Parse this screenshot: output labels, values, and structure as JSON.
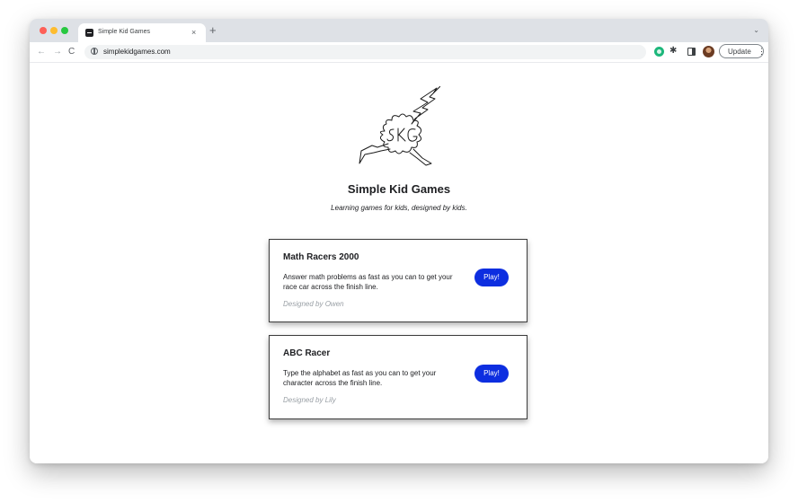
{
  "browser": {
    "tab_title": "Simple Kid Games",
    "tab_close": "×",
    "new_tab": "+",
    "tabs_dropdown": "⌄",
    "url": "simplekidgames.com",
    "nav_back": "←",
    "nav_forward": "→",
    "nav_reload": "C",
    "extension_puzzle": "✱",
    "update_label": "Update",
    "update_menu": "⋮"
  },
  "page": {
    "logo_text": "SKG",
    "title": "Simple Kid Games",
    "tagline": "Learning games for kids, designed by kids."
  },
  "games": [
    {
      "title": "Math Racers 2000",
      "description": "Answer math problems as fast as you can to get your race car across the finish line.",
      "credit": "Designed by Owen",
      "play_label": "Play!"
    },
    {
      "title": "ABC Racer",
      "description": "Type the alphabet as fast as you can to get your character across the finish line.",
      "credit": "Designed by Lily",
      "play_label": "Play!"
    }
  ],
  "colors": {
    "play_button": "#0d2ee0",
    "extension_green": "#1db77b",
    "tabstrip": "#dee1e6"
  },
  "icons": [
    "favicon-icon",
    "site-info-icon",
    "extension-icon",
    "puzzle-icon",
    "side-panel-icon",
    "avatar"
  ]
}
